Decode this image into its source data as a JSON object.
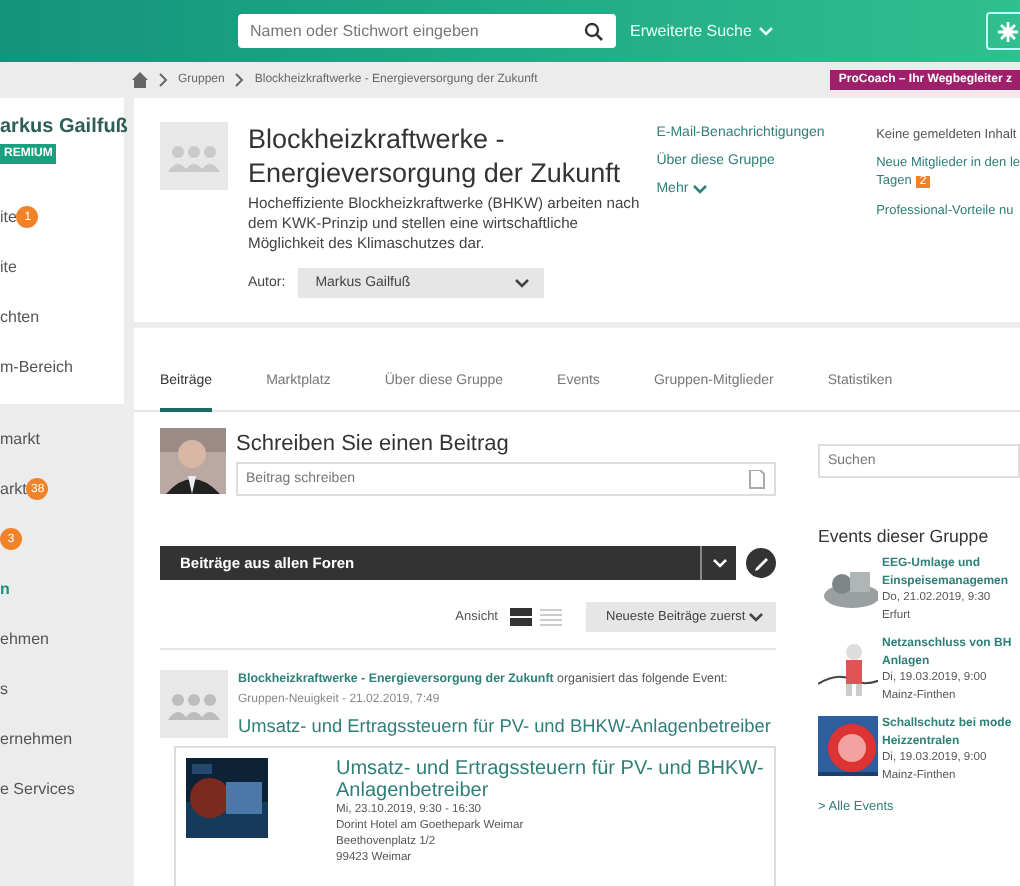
{
  "topbar": {
    "search": {
      "placeholder": "Namen oder Stichwort eingeben"
    },
    "advanced_search": "Erweiterte Suche"
  },
  "breadcrumb": [
    "Gruppen",
    "Blockheizkraftwerke - Energieversorgung der Zukunft"
  ],
  "promo": "ProCoach – Ihr Wegbegleiter z",
  "sidebar": {
    "user": "arkus Gailfuß",
    "badge": "REMIUM",
    "items": [
      {
        "label": "ite",
        "badge": "1"
      },
      {
        "label": "ite"
      },
      {
        "label": "chten"
      },
      {
        "label": "m-Bereich"
      }
    ],
    "links": [
      {
        "label": "markt",
        "selected": false
      },
      {
        "label": "arkt",
        "badge": "38",
        "selected": false
      },
      {
        "badge": "3",
        "selected": false
      },
      {
        "label": "n",
        "selected": true
      },
      {
        "label": "ehmen",
        "selected": false
      },
      {
        "label": "s",
        "selected": false
      },
      {
        "label": "ernehmen",
        "selected": false
      },
      {
        "label": "e Services",
        "selected": false
      }
    ]
  },
  "group": {
    "title": "Blockheizkraftwerke - Energieversorgung der Zukunft",
    "description": "Hocheffiziente Blockheizkraftwerke (BHKW) arbeiten nach dem KWK-Prinzip und stellen eine wirtschaftliche Möglichkeit des Klimaschutzes dar.",
    "author_label": "Autor:",
    "author": "Markus Gailfuß",
    "links": [
      {
        "label": "E-Mail-Benachrichtigungen"
      },
      {
        "label": "Über diese Gruppe"
      },
      {
        "label": "Mehr",
        "dropdown": true
      }
    ],
    "info": [
      {
        "lines": [
          "Keine gemeldeten Inhalt"
        ],
        "kind": "text"
      },
      {
        "lines": [
          "Neue Mitglieder in den le",
          "Tagen"
        ],
        "badge": "2",
        "kind": "link"
      },
      {
        "lines": [
          "Professional-Vorteile nu"
        ],
        "kind": "link"
      }
    ]
  },
  "tabs": [
    {
      "label": "Beiträge",
      "selected": true
    },
    {
      "label": "Marktplatz",
      "selected": false
    },
    {
      "label": "Über diese Gruppe",
      "selected": false
    },
    {
      "label": "Events",
      "selected": false
    },
    {
      "label": "Gruppen-Mitglieder",
      "selected": false
    },
    {
      "label": "Statistiken",
      "selected": false
    }
  ],
  "composer": {
    "heading": "Schreiben Sie einen Beitrag",
    "placeholder": "Beitrag schreiben"
  },
  "side_search": {
    "placeholder": "Suchen"
  },
  "forum_select": "Beiträge aus allen Foren",
  "view_label": "Ansicht",
  "views": [
    {
      "kind": "blocks",
      "selected": true
    },
    {
      "kind": "lines",
      "selected": false
    }
  ],
  "sort": "Neueste Beiträge zuerst",
  "post": {
    "group_link": "Blockheizkraftwerke - Energieversorgung der Zukunft",
    "action": "organisiert das folgende Event:",
    "meta": "Gruppen-Neuigkeit - 21.02.2019, 7:49",
    "title": "Umsatz- und Ertragssteuern für PV- und BHKW-Anlagenbetreiber",
    "event": {
      "title": "Umsatz- und Ertragssteuern für PV- und BHKW-Anlagenbetreiber",
      "lines": [
        "Mi, 23.10.2019, 9:30 - 16:30",
        "Dorint Hotel am Goethepark Weimar",
        "Beethovenplatz 1/2",
        "99423 Weimar"
      ]
    }
  },
  "events": {
    "heading": "Events dieser Gruppe",
    "items": [
      {
        "title": [
          "EEG-Umlage und",
          "Einspeisemanagemen"
        ],
        "date": "Do, 21.02.2019, 9:30",
        "place": "Erfurt"
      },
      {
        "title": [
          "Netzanschluss von BH",
          "Anlagen"
        ],
        "date": "Di, 19.03.2019, 9:00",
        "place": "Mainz-Finthen"
      },
      {
        "title": [
          "Schallschutz bei mode",
          "Heizzentralen"
        ],
        "date": "Di, 19.03.2019, 9:00",
        "place": "Mainz-Finthen"
      }
    ],
    "all_link": "> Alle Events"
  }
}
